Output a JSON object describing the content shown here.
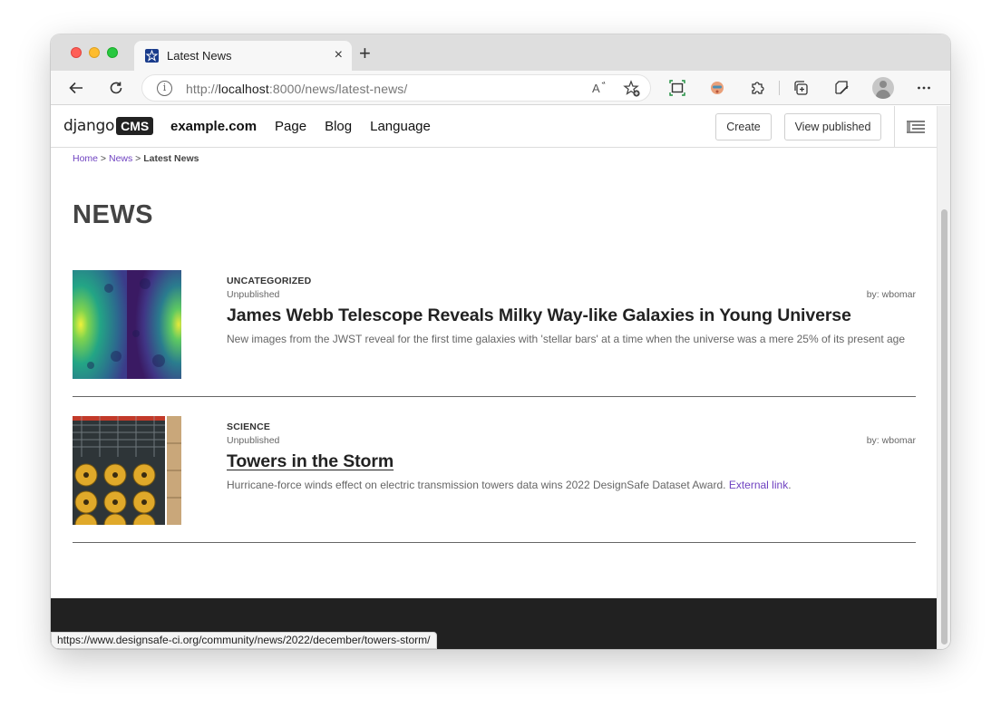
{
  "browser": {
    "tab_title": "Latest News",
    "tab_close": "×",
    "new_tab": "+",
    "url_scheme_host_prefix": "http://",
    "url_host": "localhost",
    "url_rest": ":8000/news/latest-news/",
    "status_url": "https://www.designsafe-ci.org/community/news/2022/december/towers-storm/"
  },
  "cms_toolbar": {
    "logo_text": "django",
    "logo_badge": "CMS",
    "site": "example.com",
    "menu": [
      "Page",
      "Blog",
      "Language"
    ],
    "create_label": "Create",
    "view_published_label": "View published"
  },
  "breadcrumb": {
    "home": "Home",
    "sep1": " > ",
    "news": "News",
    "sep2": " > ",
    "current": "Latest News"
  },
  "page_title": "NEWS",
  "articles": [
    {
      "category": "UNCATEGORIZED",
      "status": "Unpublished",
      "author": "by: wbomar",
      "title": "James Webb Telescope Reveals Milky Way-like Galaxies in Young Universe",
      "lead": "New images from the JWST reveal for the first time galaxies with 'stellar bars' at a time when the universe was a mere 25% of its present age",
      "link_text": ""
    },
    {
      "category": "SCIENCE",
      "status": "Unpublished",
      "author": "by: wbomar",
      "title": "Towers in the Storm",
      "lead": "Hurricane-force winds effect on electric transmission towers data wins 2022 DesignSafe Dataset Award. ",
      "link_text": "External link",
      "lead_end": "."
    }
  ],
  "colors": {
    "link": "#6f42c1",
    "footer": "#212121",
    "accent_dark": "#222222"
  }
}
